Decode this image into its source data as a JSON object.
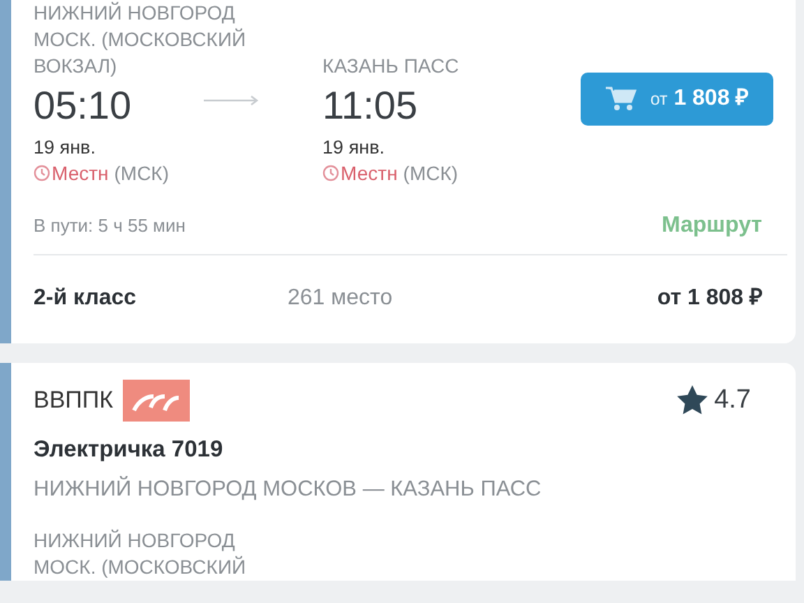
{
  "trip": {
    "departure": {
      "station_lines": [
        "НИЖНИЙ НОВГОРОД",
        "МОСК. (МОСКОВСКИЙ",
        "ВОКЗАЛ)"
      ],
      "time": "05:10",
      "date": "19 янв.",
      "tz_local": "Местн",
      "tz_ref": "(МСК)"
    },
    "arrival": {
      "station_lines": [
        "КАЗАНЬ ПАСС"
      ],
      "time": "11:05",
      "date": "19 янв.",
      "tz_local": "Местн",
      "tz_ref": "(МСК)"
    },
    "buy_button": {
      "prefix": "от",
      "price": "1 808 ₽"
    },
    "duration": "В пути: 5 ч 55 мин",
    "route_link": "Маршрут",
    "classes": [
      {
        "name": "2-й класс",
        "seats": "261 место",
        "price": "от 1 808 ₽"
      }
    ]
  },
  "next_trip": {
    "carrier": "ВВППК",
    "rating": "4.7",
    "train": "Электричка 7019",
    "route": "НИЖНИЙ НОВГОРОД МОСКОВ — КАЗАНЬ ПАСС",
    "departure": {
      "station_lines": [
        "НИЖНИЙ НОВГОРОД",
        "МОСК. (МОСКОВСКИЙ"
      ]
    }
  }
}
